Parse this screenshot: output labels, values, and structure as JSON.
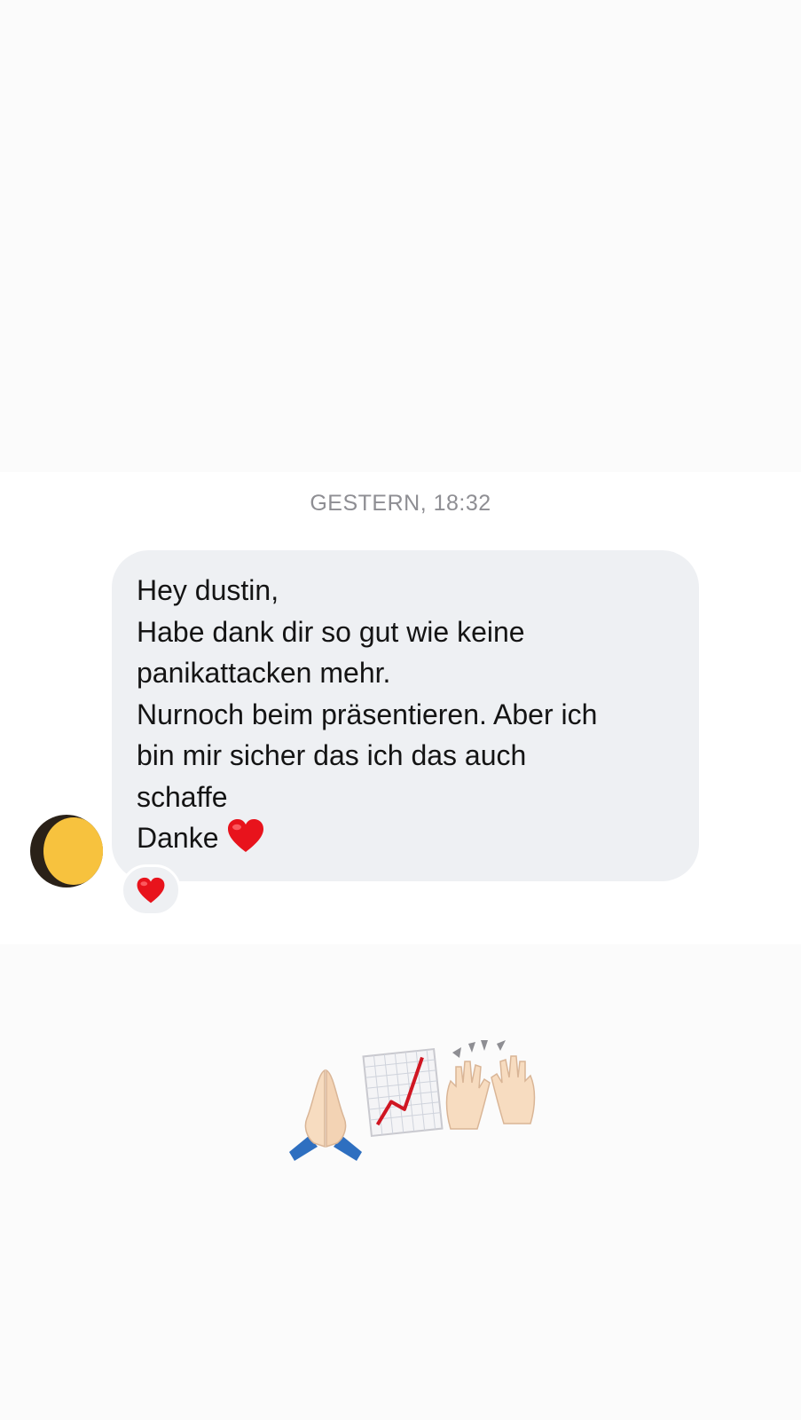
{
  "conversation": {
    "timestamp": "GESTERN, 18:32",
    "message": {
      "lines": [
        "Hey dustin,",
        "Habe dank dir so gut wie keine",
        "panikattacken mehr.",
        "Nurnoch beim präsentieren. Aber ich",
        "bin mir sicher das ich das auch",
        "schaffe",
        "Danke"
      ],
      "inline_emoji": "red-heart",
      "reaction": "red-heart"
    },
    "sender_avatar": "censored-avatar"
  },
  "caption_emojis": [
    "folded-hands",
    "chart-increasing",
    "raising-hands"
  ],
  "colors": {
    "bubble": "#eef0f3",
    "timestamp": "#8e8e93",
    "heart": "#e8131c",
    "avatar_censor": "#f7c23e"
  }
}
